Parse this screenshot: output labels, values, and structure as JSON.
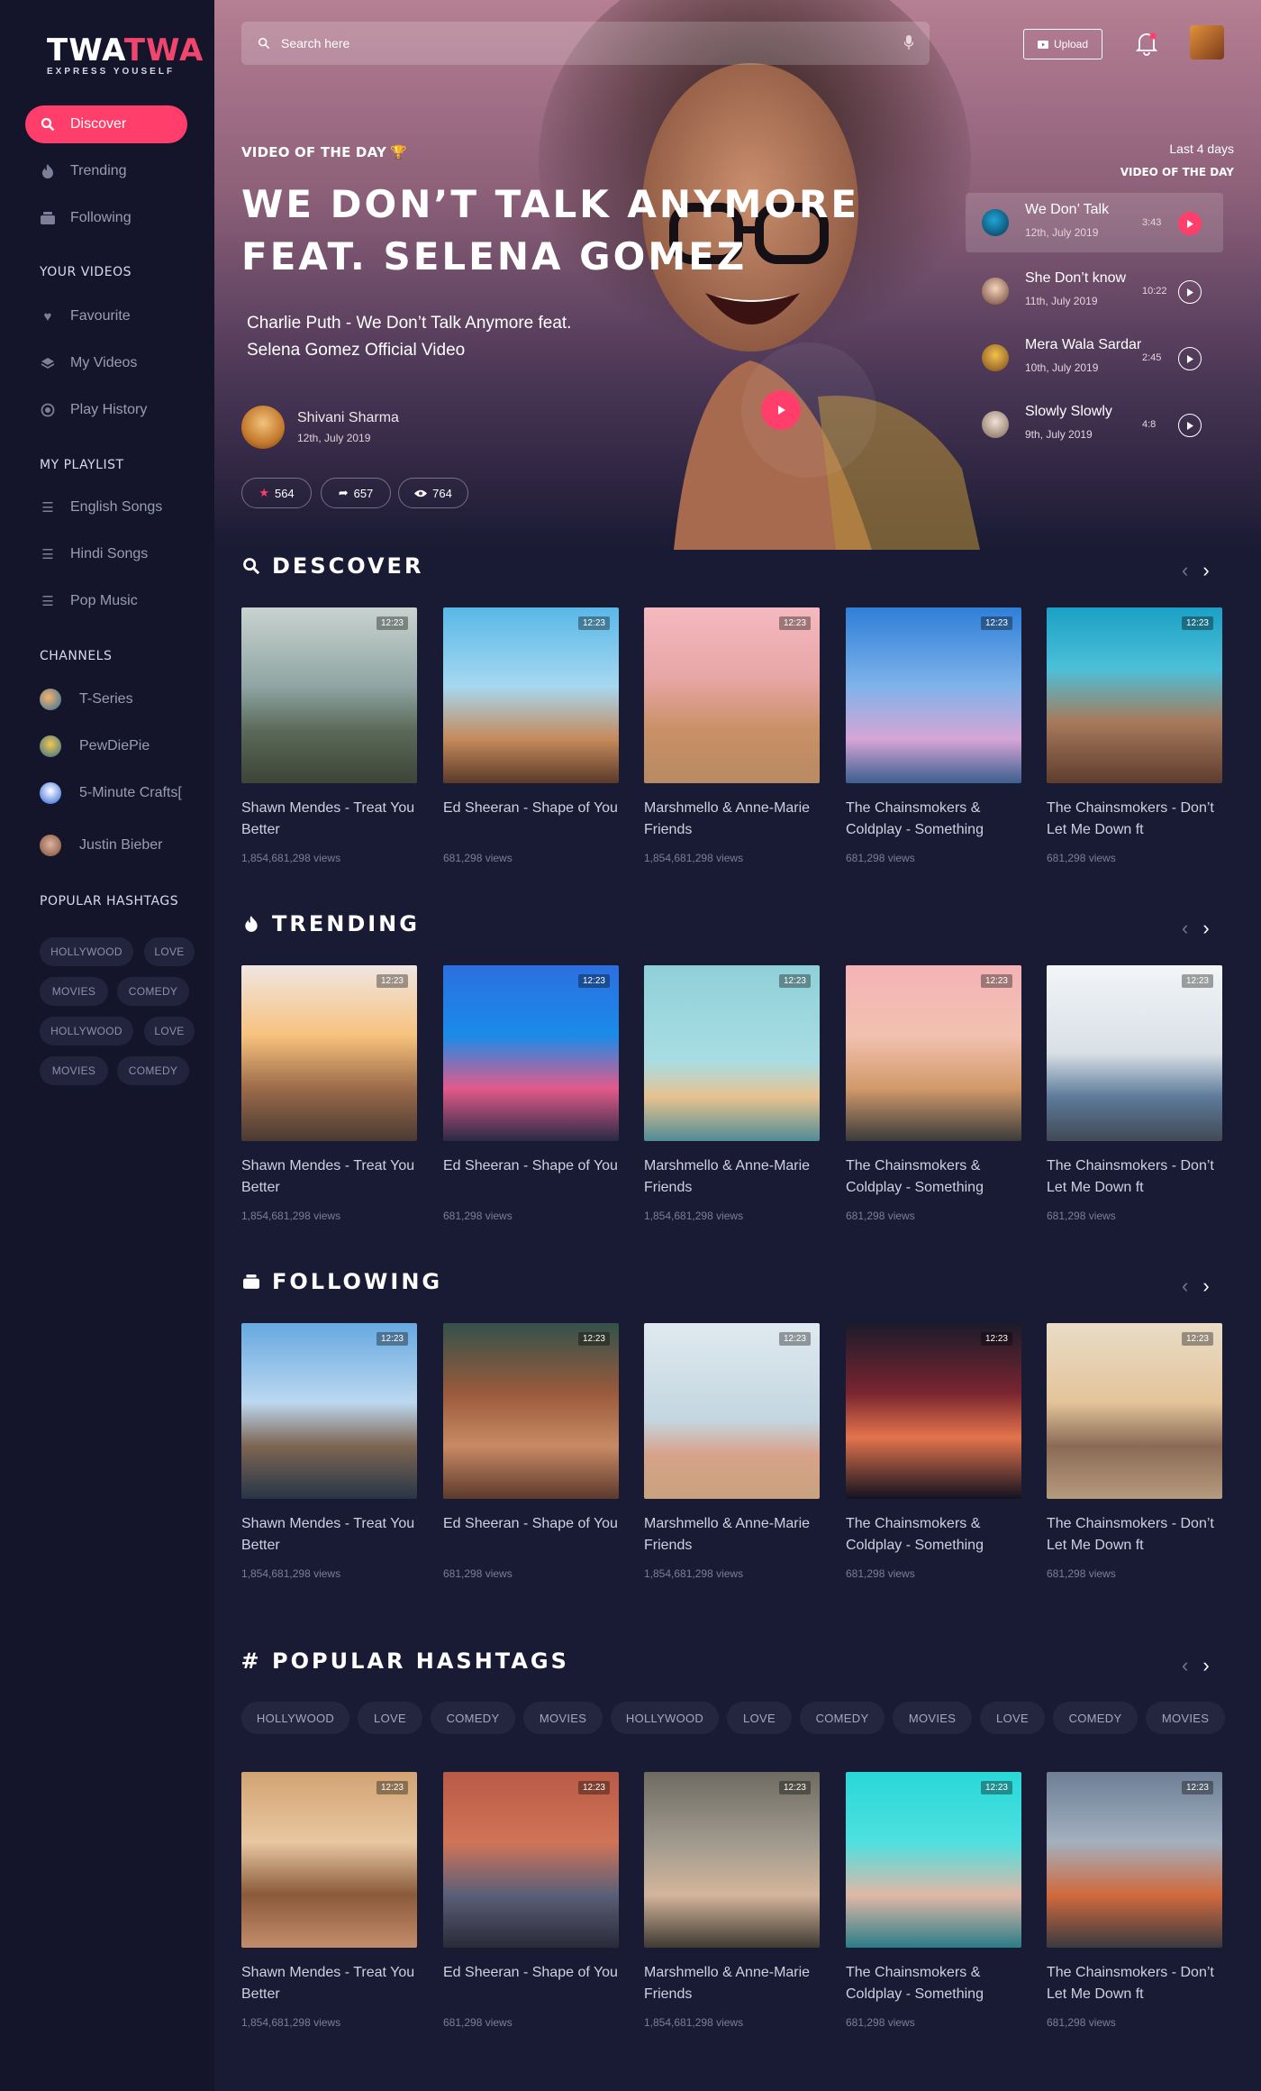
{
  "app": {
    "logo_a": "TWA",
    "logo_b": "TWA",
    "tagline": "EXPRESS YOUSELF"
  },
  "sidebar": {
    "nav": [
      {
        "label": "Discover",
        "icon": "search-icon"
      },
      {
        "label": "Trending",
        "icon": "flame-icon"
      },
      {
        "label": "Following",
        "icon": "following-icon"
      }
    ],
    "your_videos_heading": "YOUR VIDEOS",
    "your_videos": [
      {
        "label": "Favourite",
        "icon": "heart-icon"
      },
      {
        "label": "My Videos",
        "icon": "layers-icon"
      },
      {
        "label": "Play History",
        "icon": "history-icon"
      }
    ],
    "playlist_heading": "MY PLAYLIST",
    "playlists": [
      {
        "label": "English Songs",
        "icon": "list-icon"
      },
      {
        "label": "Hindi Songs",
        "icon": "list-icon"
      },
      {
        "label": "Pop Music",
        "icon": "list-icon"
      }
    ],
    "channels_heading": "CHANNELS",
    "channels": [
      {
        "label": "T-Series"
      },
      {
        "label": "PewDiePie"
      },
      {
        "label": "5-Minute Crafts["
      },
      {
        "label": "Justin Bieber"
      }
    ],
    "hashtags_heading": "POPULAR HASHTAGS",
    "hashtags": [
      "HOLLYWOOD",
      "LOVE",
      "MOVIES",
      "COMEDY",
      "HOLLYWOOD",
      "LOVE",
      "MOVIES",
      "COMEDY"
    ]
  },
  "header": {
    "search_placeholder": "Search here",
    "upload_label": "Upload"
  },
  "hero": {
    "badge": "VIDEO OF THE DAY",
    "title_line1": "WE DON’T TALK ANYMORE",
    "title_line2": "FEAT. SELENA GOMEZ",
    "description": "Charlie Puth - We Don’t Talk Anymore feat. Selena Gomez Official Video",
    "author": "Shivani Sharma",
    "date": "12th, July 2019",
    "stats": {
      "likes": "564",
      "shares": "657",
      "views": "764"
    },
    "side_heading": "Last 4 days",
    "side_subheading": "VIDEO OF THE DAY",
    "playlist": [
      {
        "title": "We Don’ Talk",
        "date": "12th, July 2019",
        "duration": "3:43"
      },
      {
        "title": "She Don’t know",
        "date": "11th, July 2019",
        "duration": "10:22"
      },
      {
        "title": "Mera Wala Sardar",
        "date": "10th, July 2019",
        "duration": "2:45"
      },
      {
        "title": "Slowly Slowly",
        "date": "9th, July 2019",
        "duration": "4:8"
      }
    ]
  },
  "sections": {
    "discover": "DESCOVER",
    "trending": "TRENDING",
    "following": "FOLLOWING",
    "hashtags": "POPULAR HASHTAGS"
  },
  "videos": [
    {
      "title": "Shawn Mendes - Treat You Better",
      "views": "1,854,681,298 views",
      "duration": "12:23"
    },
    {
      "title": "Ed Sheeran - Shape of You",
      "views": "681,298 views",
      "duration": "12:23"
    },
    {
      "title": "Marshmello & Anne-Marie Friends",
      "views": "1,854,681,298 views",
      "duration": "12:23"
    },
    {
      "title": "The Chainsmokers & Coldplay - Something",
      "views": "681,298 views",
      "duration": "12:23"
    },
    {
      "title": "The Chainsmokers - Don’t Let Me Down ft",
      "views": "681,298 views",
      "duration": "12:23"
    }
  ],
  "hashtag_row": [
    "HOLLYWOOD",
    "LOVE",
    "COMEDY",
    "MOVIES",
    "HOLLYWOOD",
    "LOVE",
    "COMEDY",
    "MOVIES",
    "LOVE",
    "COMEDY",
    "MOVIES"
  ],
  "colors": {
    "accent": "#ff3e6b",
    "sidebar": "#14152b",
    "background": "#191a33"
  }
}
